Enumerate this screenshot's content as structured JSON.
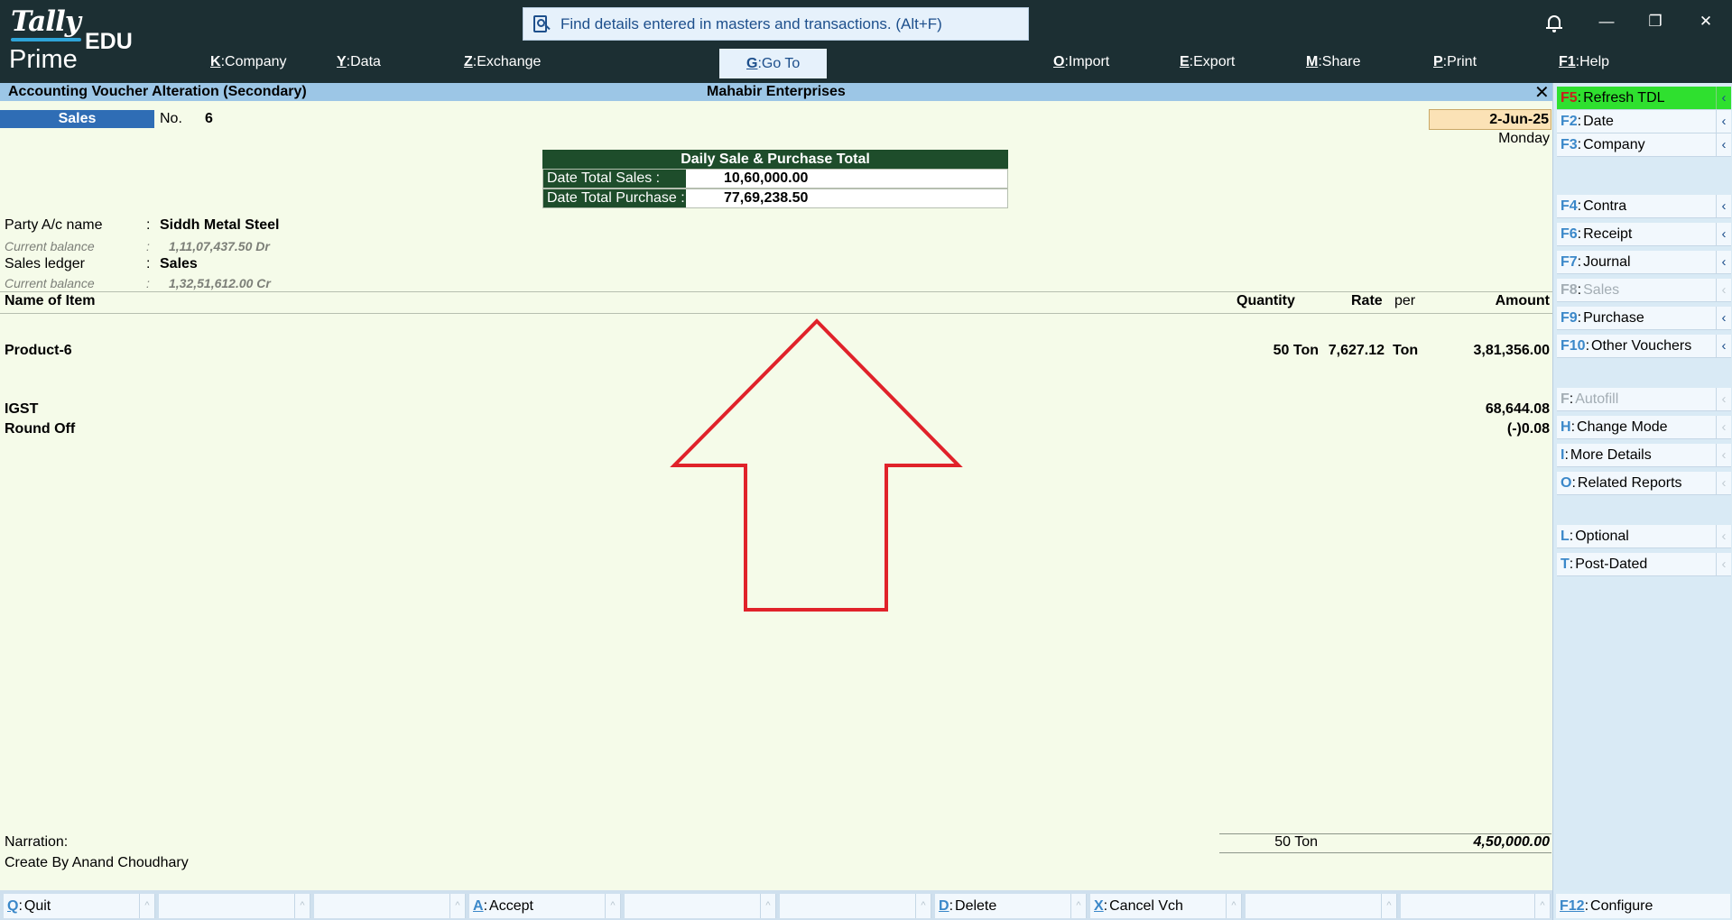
{
  "brand": {
    "tally": "Tally",
    "prime": "Prime",
    "edition": "EDU"
  },
  "search": {
    "placeholder": "Find details entered in masters and transactions. (Alt+F)"
  },
  "menu": [
    {
      "key": "K",
      "label": "Company"
    },
    {
      "key": "Y",
      "label": "Data"
    },
    {
      "key": "Z",
      "label": "Exchange"
    },
    {
      "key": "G",
      "label": "Go To"
    },
    {
      "key": "O",
      "label": "Import"
    },
    {
      "key": "E",
      "label": "Export"
    },
    {
      "key": "M",
      "label": "Share"
    },
    {
      "key": "P",
      "label": "Print"
    },
    {
      "key": "F1",
      "label": "Help"
    }
  ],
  "window_controls": {
    "minimize": "—",
    "restore": "❐",
    "close": "✕"
  },
  "titlebar": {
    "left": "Accounting Voucher Alteration (Secondary)",
    "center": "Mahabir Enterprises",
    "close": "✕"
  },
  "voucher": {
    "type": "Sales",
    "no_label": "No.",
    "no": "6",
    "date": "2-Jun-25",
    "day": "Monday"
  },
  "daily_total": {
    "title": "Daily Sale & Purchase Total",
    "rows": [
      {
        "label": "Date  Total   Sales    :",
        "value": "10,60,000.00"
      },
      {
        "label": "Date Total Purchase :",
        "value": "77,69,238.50"
      }
    ]
  },
  "party": {
    "label": "Party A/c name",
    "colon": ":",
    "name": "Siddh Metal Steel",
    "balance_label": "Current balance",
    "balance": "1,11,07,437.50 Dr"
  },
  "ledger": {
    "label": "Sales ledger",
    "colon": ":",
    "name": "Sales",
    "balance_label": "Current balance",
    "balance": "1,32,51,612.00 Cr"
  },
  "columns": {
    "name": "Name of Item",
    "quantity": "Quantity",
    "rate": "Rate",
    "per": "per",
    "amount": "Amount"
  },
  "items": [
    {
      "name": "Product-6",
      "quantity": "50 Ton",
      "rate": "7,627.12",
      "per": "Ton",
      "amount": "3,81,356.00"
    }
  ],
  "taxes": [
    {
      "name": "IGST",
      "amount": "68,644.08"
    },
    {
      "name": "Round Off",
      "amount": "(-)0.08"
    }
  ],
  "narration": {
    "label": "Narration:",
    "text": "Create By Anand Choudhary"
  },
  "totals": {
    "quantity": "50 Ton",
    "amount": "4,50,000.00"
  },
  "right_panel": [
    {
      "key": "F5",
      "label": "Refresh TDL",
      "state": "green"
    },
    {
      "key": "F2",
      "label": "Date",
      "state": "enabled"
    },
    {
      "key": "F3",
      "label": "Company",
      "state": "enabled"
    },
    {
      "key": "F4",
      "label": "Contra",
      "state": "enabled"
    },
    {
      "key": "F6",
      "label": "Receipt",
      "state": "enabled"
    },
    {
      "key": "F7",
      "label": "Journal",
      "state": "enabled"
    },
    {
      "key": "F8",
      "label": "Sales",
      "state": "disabled"
    },
    {
      "key": "F9",
      "label": "Purchase",
      "state": "enabled"
    },
    {
      "key": "F10",
      "label": "Other Vouchers",
      "state": "enabled"
    },
    {
      "key": "F",
      "label": "Autofill",
      "state": "disabled"
    },
    {
      "key": "H",
      "label": "Change Mode",
      "state": "enabled"
    },
    {
      "key": "I",
      "label": "More Details",
      "state": "enabled"
    },
    {
      "key": "O",
      "label": "Related Reports",
      "state": "enabled"
    },
    {
      "key": "L",
      "label": "Optional",
      "state": "enabled"
    },
    {
      "key": "T",
      "label": "Post-Dated",
      "state": "enabled"
    }
  ],
  "bottom_bar": [
    {
      "key": "Q",
      "label": "Quit"
    },
    {
      "key": "",
      "label": ""
    },
    {
      "key": "",
      "label": ""
    },
    {
      "key": "A",
      "label": "Accept"
    },
    {
      "key": "",
      "label": ""
    },
    {
      "key": "",
      "label": ""
    },
    {
      "key": "D",
      "label": "Delete"
    },
    {
      "key": "X",
      "label": "Cancel Vch"
    },
    {
      "key": "",
      "label": ""
    },
    {
      "key": "",
      "label": ""
    }
  ],
  "configure": {
    "key": "F12",
    "label": "Configure"
  },
  "colors": {
    "topbar": "#1c2f33",
    "accent": "#3b88c9",
    "background": "#f5fbe9",
    "annotation": "#e0222a",
    "voucher_type": "#2f6db5",
    "daily_total_header": "#1e4d2b"
  }
}
